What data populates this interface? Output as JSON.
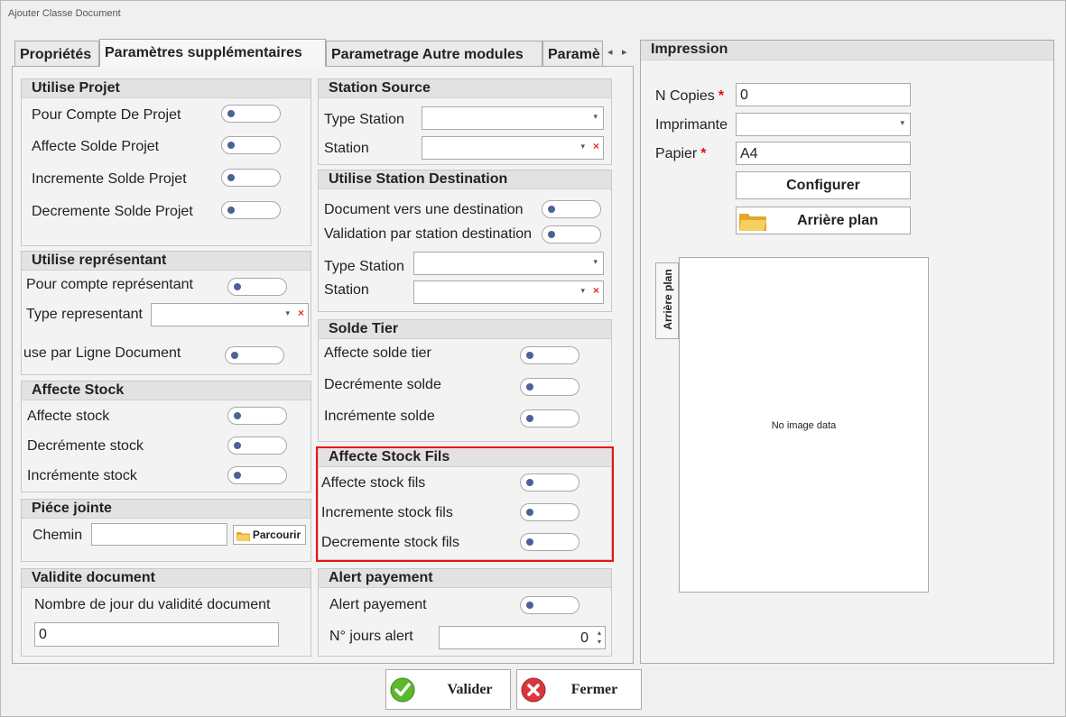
{
  "window": {
    "title": "Ajouter Classe Document"
  },
  "tabs": [
    {
      "label": "Propriétés"
    },
    {
      "label": "Paramètres supplémentaires"
    },
    {
      "label": "Parametrage Autre modules"
    },
    {
      "label": "Paramè"
    }
  ],
  "utilise_projet": {
    "title": "Utilise Projet",
    "items": [
      "Pour Compte De Projet",
      "Affecte Solde Projet",
      "Incremente Solde Projet",
      "Decremente Solde Projet"
    ]
  },
  "utilise_representant": {
    "title": "Utilise représentant",
    "pour_compte": "Pour compte représentant",
    "type_label": "Type representant",
    "ligne_label": "use par Ligne Document"
  },
  "affecte_stock": {
    "title": "Affecte Stock",
    "items": [
      "Affecte stock",
      "Decrémente stock",
      "Incrémente stock"
    ]
  },
  "piece_jointe": {
    "title": "Piéce jointe",
    "chemin_label": "Chemin",
    "chemin_value": "",
    "parcourir_label": "Parcourir"
  },
  "validite": {
    "title": "Validite document",
    "label": "Nombre de jour du validité document",
    "value": "0"
  },
  "station_source": {
    "title": "Station Source",
    "type_label": "Type Station",
    "station_label": "Station"
  },
  "station_destination": {
    "title": "Utilise Station Destination",
    "doc_vers": "Document vers une destination",
    "validation": "Validation par station destination",
    "type_label": "Type Station",
    "station_label": "Station"
  },
  "solde_tier": {
    "title": "Solde Tier",
    "items": [
      "Affecte solde tier",
      "Decrémente solde",
      "Incrémente solde"
    ]
  },
  "affecte_stock_fils": {
    "title": "Affecte Stock Fils",
    "items": [
      "Affecte stock fils",
      "Incremente stock fils",
      "Decremente stock fils"
    ]
  },
  "alert_payement": {
    "title": "Alert payement",
    "label": "Alert payement",
    "jours_label": "N° jours alert",
    "jours_value": "0"
  },
  "impression": {
    "title": "Impression",
    "copies_label": "N Copies",
    "copies_value": "0",
    "imprimante_label": "Imprimante",
    "papier_label": "Papier",
    "papier_value": "A4",
    "required_mark": "*",
    "configurer_label": "Configurer",
    "arriere_plan_label": "Arrière plan",
    "vertical_tab_label": "Arrière plan",
    "no_image_text": "No image data"
  },
  "footer": {
    "valider_label": "Valider",
    "fermer_label": "Fermer"
  },
  "colors": {
    "highlight": "#e11111",
    "toggle_knob": "#4a6396",
    "valider_green": "#5cb82e",
    "fermer_red": "#d9363e"
  }
}
